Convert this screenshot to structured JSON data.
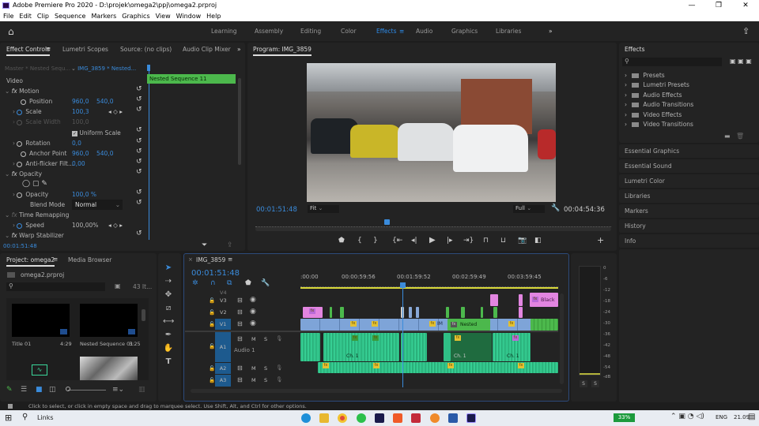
{
  "window": {
    "title": "Adobe Premiere Pro 2020 - D:\\projek\\omega2\\ppj\\omega2.prproj",
    "controls": [
      "—",
      "❐",
      "✕"
    ]
  },
  "menu": [
    "File",
    "Edit",
    "Clip",
    "Sequence",
    "Markers",
    "Graphics",
    "View",
    "Window",
    "Help"
  ],
  "workspaces": [
    "Learning",
    "Assembly",
    "Editing",
    "Color",
    "Effects",
    "Audio",
    "Graphics",
    "Libraries"
  ],
  "workspace_active": "Effects",
  "effect_controls": {
    "tabs": [
      "Effect Controls",
      "Lumetri Scopes",
      "Source: (no clips)",
      "Audio Clip Mixer"
    ],
    "master": "Master * Nested Sequ...",
    "clip": "IMG_3859 * Nested...",
    "section": "Video",
    "clip_bar": "Nested Sequence 11",
    "rows": [
      {
        "label": "Motion"
      },
      {
        "label": "Position",
        "v1": "960,0",
        "v2": "540,0"
      },
      {
        "label": "Scale",
        "v1": "100,3"
      },
      {
        "label": "Scale Width",
        "v1": "100,0"
      },
      {
        "label": "Uniform Scale"
      },
      {
        "label": "Rotation",
        "v1": "0,0"
      },
      {
        "label": "Anchor Point",
        "v1": "960,0",
        "v2": "540,0"
      },
      {
        "label": "Anti-flicker Filt...",
        "v1": "0,00"
      },
      {
        "label": "Opacity"
      },
      {
        "label": "Opacity",
        "v1": "100,0 %"
      },
      {
        "label": "Blend Mode",
        "v1": "Normal"
      },
      {
        "label": "Time Remapping"
      },
      {
        "label": "Speed",
        "v1": "100,00%"
      },
      {
        "label": "Warp Stabilizer"
      }
    ],
    "timecode": "00:01:51:48"
  },
  "program": {
    "title": "Program: IMG_3859",
    "timecode": "00:01:51:48",
    "fit": "Fit",
    "quality": "Full",
    "duration": "00:04:54:36"
  },
  "effects_panel": {
    "title": "Effects",
    "items": [
      "Presets",
      "Lumetri Presets",
      "Audio Effects",
      "Audio Transitions",
      "Video Effects",
      "Video Transitions"
    ],
    "collapsed": [
      "Essential Graphics",
      "Essential Sound",
      "Lumetri Color",
      "Libraries",
      "Markers",
      "History",
      "Info"
    ]
  },
  "project": {
    "tabs": [
      "Project: omega2",
      "Media Browser"
    ],
    "file": "omega2.prproj",
    "count": "43 It...",
    "items": [
      {
        "name": "Title 01",
        "dur": "4:29"
      },
      {
        "name": "Nested Sequence 01",
        "dur": "3:25"
      }
    ]
  },
  "timeline": {
    "title": "IMG_3859",
    "timecode": "00:01:51:48",
    "ruler": [
      ":00:00",
      "00:00:59:56",
      "00:01:59:52",
      "00:02:59:49",
      "00:03:59:45"
    ],
    "tracks_video": [
      "V4",
      "V3",
      "V2",
      "V1"
    ],
    "tracks_audio": [
      "A1",
      "A2",
      "A3"
    ],
    "audio1_name": "Audio 1",
    "clip_labels": {
      "black": "Black",
      "im": "IM",
      "nested": "Nested Seque",
      "ch1a": "Ch. 1",
      "ch1b": "Ch. 1",
      "ch1c": "Ch. 1"
    },
    "m": "M",
    "s": "S"
  },
  "meter": {
    "scale": [
      "0",
      "-6",
      "-12",
      "-18",
      "-24",
      "-30",
      "-36",
      "-42",
      "-48",
      "-54",
      "-dB"
    ],
    "solo": [
      "S",
      "S"
    ]
  },
  "status": "Click to select, or click in empty space and drag to marquee select. Use Shift, Alt, and Ctrl for other options.",
  "taskbar": {
    "search": "Links",
    "battery": "33%",
    "lang": "ENG",
    "time": "21.09"
  }
}
